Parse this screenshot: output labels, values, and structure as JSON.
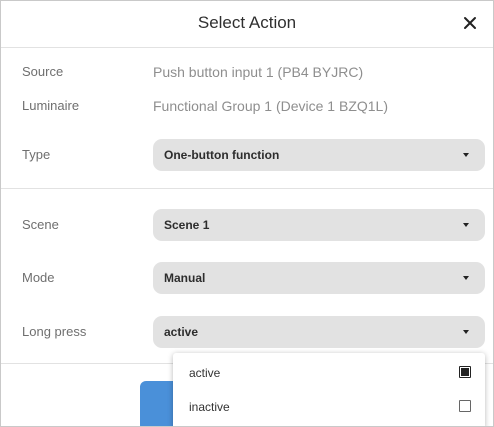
{
  "dialog": {
    "title": "Select Action",
    "close_glyph": "✕"
  },
  "fields": {
    "source": {
      "label": "Source",
      "value": "Push button input 1 (PB4 BYJRC)"
    },
    "luminaire": {
      "label": "Luminaire",
      "value": "Functional Group 1 (Device 1 BZQ1L)"
    },
    "type": {
      "label": "Type",
      "value": "One-button function"
    },
    "scene": {
      "label": "Scene",
      "value": "Scene 1"
    },
    "mode": {
      "label": "Mode",
      "value": "Manual"
    },
    "long_press": {
      "label": "Long press",
      "value": "active"
    }
  },
  "dropdown": {
    "options": [
      {
        "label": "active",
        "checked": true
      },
      {
        "label": "inactive",
        "checked": false
      }
    ]
  },
  "colors": {
    "primary_button": "#4a90d9",
    "select_bg": "#e2e2e2"
  },
  "icons": {
    "close": "close-icon",
    "caret": "caret-down-icon",
    "checkbox_checked": "checkbox-checked-icon",
    "checkbox_unchecked": "checkbox-unchecked-icon"
  }
}
